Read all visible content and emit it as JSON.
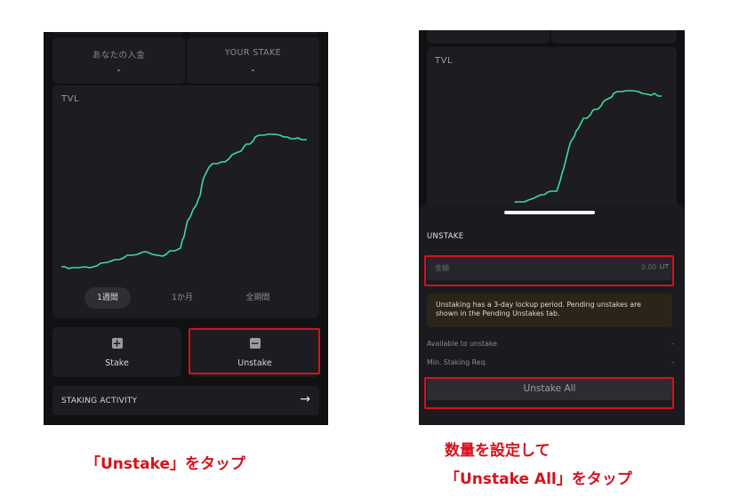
{
  "left": {
    "stat_deposit": {
      "label": "あなたの入金",
      "value": "-"
    },
    "stat_stake": {
      "label": "YOUR STAKE",
      "value": "-"
    },
    "chart_label": "TVL",
    "periods": [
      "1週間",
      "1か月",
      "全期間"
    ],
    "active_period": "1週間",
    "stake_label": "Stake",
    "unstake_label": "Unstake",
    "activity_label": "STAKING ACTIVITY",
    "arrow": "→"
  },
  "right": {
    "top_values": [
      "-",
      "-"
    ],
    "chart_label": "TVL",
    "sheet_title": "UNSTAKE",
    "amount_placeholder": "金額",
    "amount_value": "0.00",
    "amount_unit": "LIT",
    "notice": "Unstaking has a 3-day lockup period. Pending unstakes are shown in the Pending Unstakes tab.",
    "available_label": "Available to unstake",
    "available_value": "-",
    "min_label": "Min. Staking Req.",
    "min_value": "-",
    "unstake_all_label": "Unstake All"
  },
  "captions": {
    "left": "「Unstake」をタップ",
    "right_line1": "数量を設定して",
    "right_line2": "「Unstake All」をタップ"
  },
  "colors": {
    "highlight": "#d7111b",
    "line": "#3ddc97",
    "background": "#111114"
  },
  "icons": {
    "plus": "plus-icon",
    "minus": "minus-icon",
    "arrow": "arrow-right-icon"
  }
}
